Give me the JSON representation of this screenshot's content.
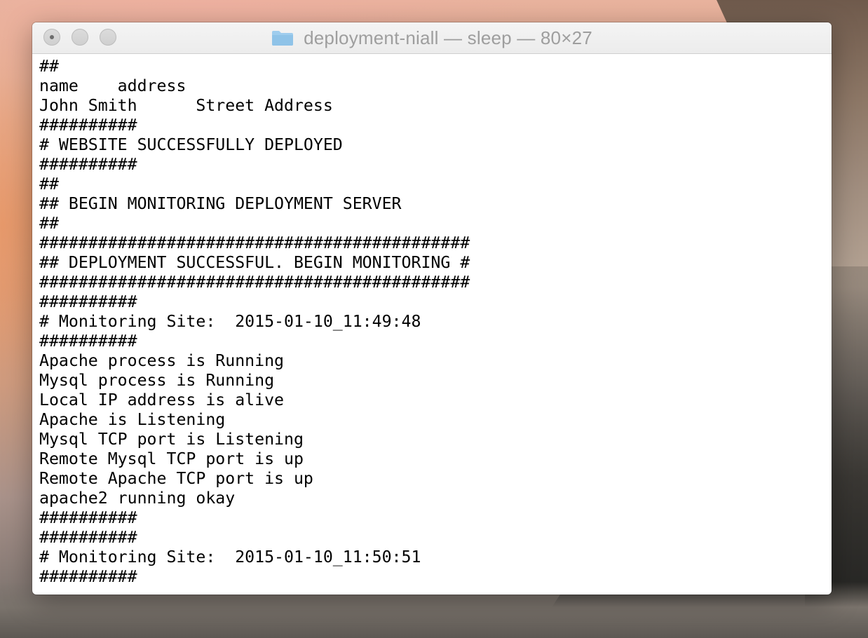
{
  "window": {
    "title": "deployment-niall — sleep — 80×27",
    "icon": "folder-icon",
    "controls": [
      "close-button",
      "minimize-button",
      "zoom-button"
    ]
  },
  "terminal": {
    "lines": [
      "##",
      "name    address",
      "John Smith      Street Address",
      "##########",
      "# WEBSITE SUCCESSFULLY DEPLOYED",
      "##########",
      "##",
      "## BEGIN MONITORING DEPLOYMENT SERVER",
      "##",
      "############################################",
      "## DEPLOYMENT SUCCESSFUL. BEGIN MONITORING #",
      "############################################",
      "##########",
      "# Monitoring Site:  2015-01-10_11:49:48",
      "##########",
      "Apache process is Running",
      "Mysql process is Running",
      "Local IP address is alive",
      "Apache is Listening",
      "Mysql TCP port is Listening",
      "Remote Mysql TCP port is up",
      "Remote Apache TCP port is up",
      "apache2 running okay",
      "##########",
      "##########",
      "# Monitoring Site:  2015-01-10_11:50:51",
      "##########"
    ]
  },
  "colors": {
    "terminal_bg": "#ffffff",
    "terminal_fg": "#000000",
    "title_text": "#9e9e9e",
    "folder_icon": "#8fc3e8"
  }
}
